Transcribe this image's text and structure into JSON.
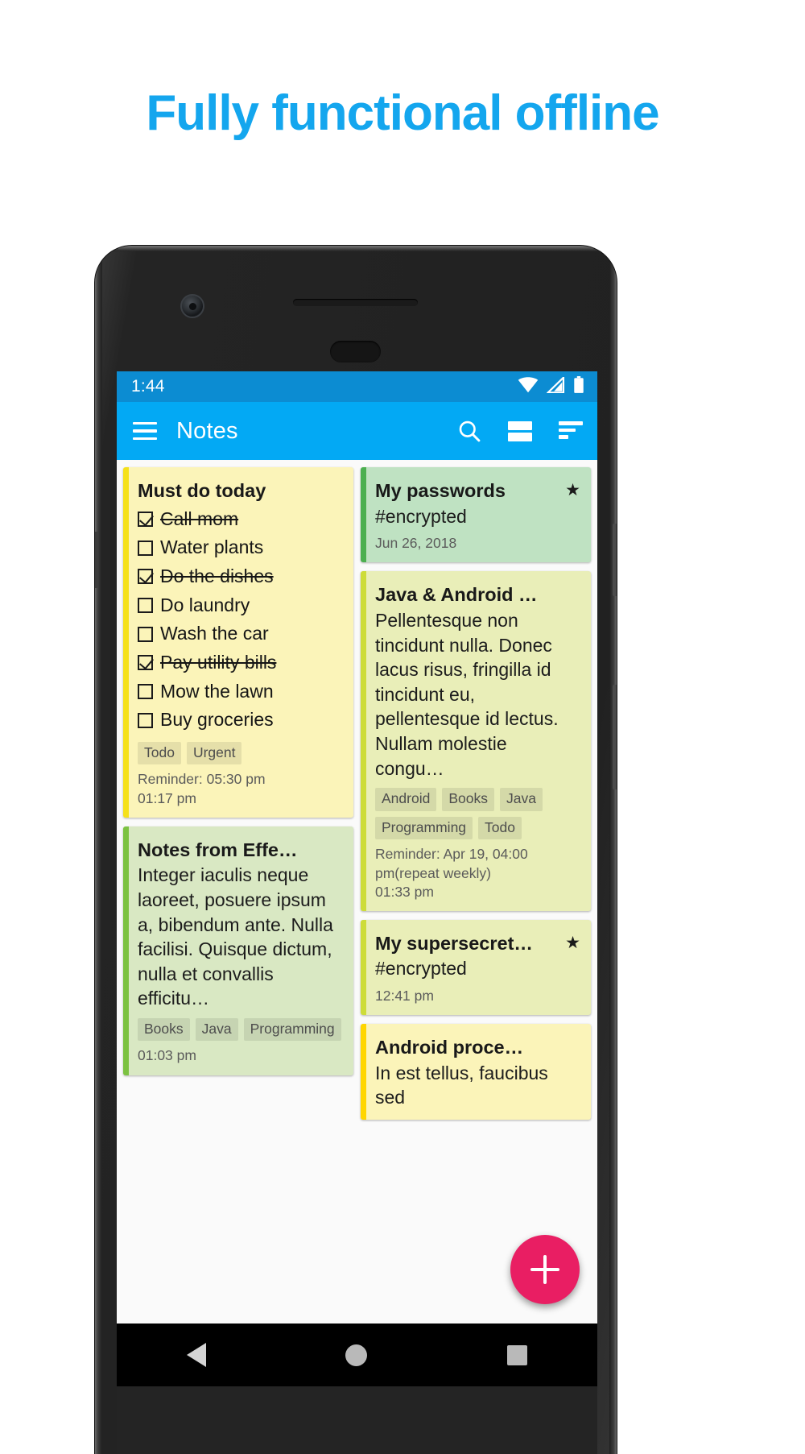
{
  "headline": "Fully functional offline",
  "theme": {
    "accent": "#03a9f4",
    "statusbar": "#0c8cd2",
    "fab": "#e91e63",
    "headline_color": "#14a6ee"
  },
  "statusbar": {
    "time": "1:44",
    "icons": [
      "wifi-icon",
      "cell-signal-icon",
      "battery-icon"
    ]
  },
  "appbar": {
    "menu_icon": "hamburger-menu-icon",
    "title": "Notes",
    "actions": [
      {
        "name": "search-icon",
        "label": "Search"
      },
      {
        "name": "layout-icon",
        "label": "Layout"
      },
      {
        "name": "sort-icon",
        "label": "Sort"
      }
    ]
  },
  "fab": {
    "label": "+",
    "name": "add-note-fab"
  },
  "navbar": {
    "back": "back-nav-icon",
    "home": "home-nav-icon",
    "recents": "recents-nav-icon"
  },
  "notes": {
    "left": [
      {
        "title": "Must do today",
        "stripe": "#f5e11a",
        "bg": "#fbf4b9",
        "starred": false,
        "checklist": [
          {
            "text": "Call mom",
            "checked": true
          },
          {
            "text": "Water plants",
            "checked": false
          },
          {
            "text": "Do the dishes",
            "checked": true
          },
          {
            "text": "Do laundry",
            "checked": false
          },
          {
            "text": "Wash the car",
            "checked": false
          },
          {
            "text": "Pay utility bills",
            "checked": true
          },
          {
            "text": "Mow the lawn",
            "checked": false
          },
          {
            "text": "Buy groceries",
            "checked": false
          }
        ],
        "tags": [
          "Todo",
          "Urgent"
        ],
        "reminder": "Reminder: 05:30 pm",
        "time": "01:17 pm"
      },
      {
        "title": "Notes from Effe…",
        "stripe": "#7cc241",
        "bg": "#d9e8c3",
        "starred": false,
        "body": "Integer iaculis neque laoreet, posuere ipsum a, bibendum ante. Nulla facilisi. Quisque dictum, nulla et convallis efficitu…",
        "tags": [
          "Books",
          "Java",
          "Programming"
        ],
        "reminder": "",
        "time": "01:03 pm"
      }
    ],
    "right": [
      {
        "title": "My passwords",
        "stripe": "#4caf50",
        "bg": "#bfe2c2",
        "starred": true,
        "body": "#encrypted",
        "tags": [],
        "reminder": "",
        "time": "Jun 26, 2018"
      },
      {
        "title": "Java & Android …",
        "stripe": "#cddc39",
        "bg": "#e9eeb8",
        "starred": false,
        "body": "Pellentesque non tincidunt nulla. Donec lacus risus, fringilla id tincidunt eu, pellentesque id lectus. Nullam molestie congu…",
        "tags": [
          "Android",
          "Books",
          "Java",
          "Programming",
          "Todo"
        ],
        "reminder": "Reminder: Apr 19, 04:00 pm(repeat weekly)",
        "time": "01:33 pm"
      },
      {
        "title": "My supersecret…",
        "stripe": "#cddc39",
        "bg": "#e9eeb8",
        "starred": true,
        "body": "#encrypted",
        "tags": [],
        "reminder": "",
        "time": "12:41 pm"
      },
      {
        "title": "Android proce…",
        "stripe": "#ffd600",
        "bg": "#fbf4b9",
        "starred": false,
        "body": "In est tellus, faucibus sed",
        "tags": [],
        "reminder": "",
        "time": ""
      }
    ]
  }
}
